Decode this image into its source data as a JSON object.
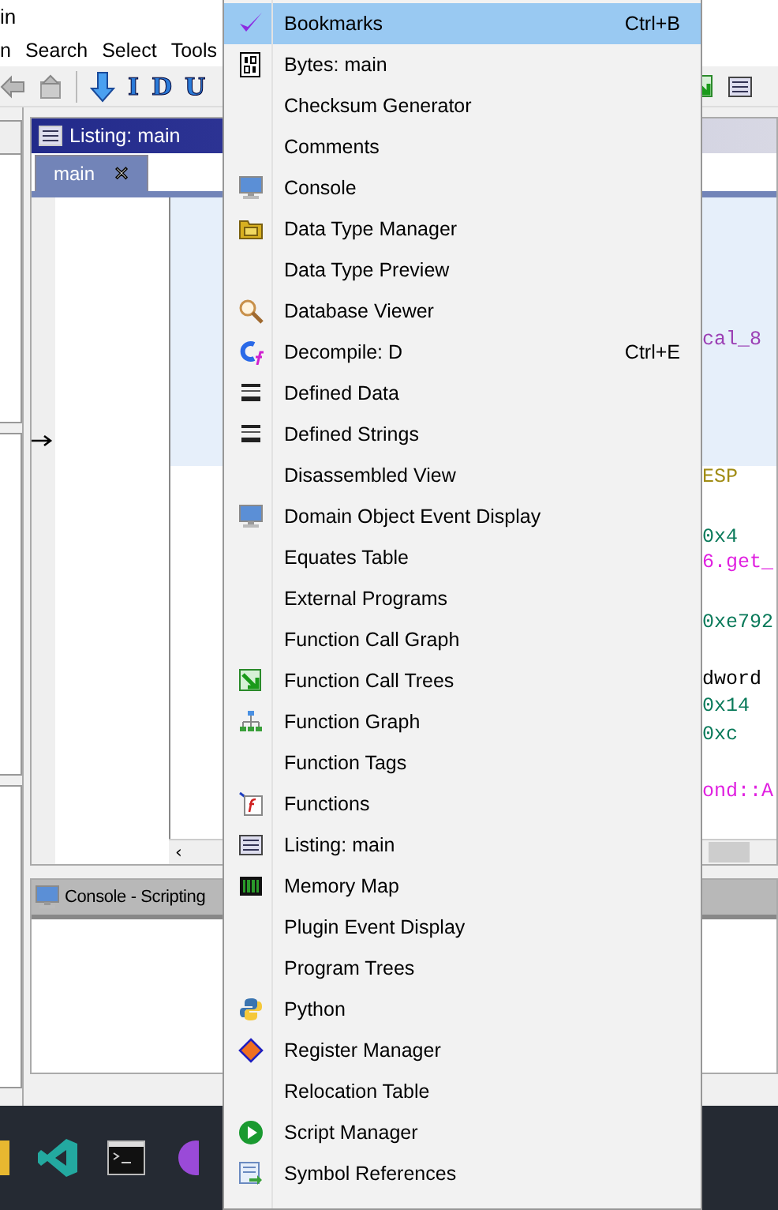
{
  "window": {
    "title": "in"
  },
  "menu_bar": [
    "n",
    "Search",
    "Select",
    "Tools"
  ],
  "toolbar": {
    "letters": [
      "I",
      "D",
      "U"
    ]
  },
  "listing": {
    "title": "Listing: main",
    "tabs": [
      {
        "label": "main",
        "close": "✕",
        "selected": true
      }
    ],
    "scroll_left": "‹",
    "code": [
      {
        "text": "cal_8",
        "color": "#9b3fb4"
      },
      {
        "text": "ESP",
        "color": "#a08c14"
      },
      {
        "text": "0x4",
        "color": "#0a7a5a"
      },
      {
        "text": "6.get_",
        "color": "#e020e0"
      },
      {
        "text": "0xe792",
        "color": "#0a7a5a"
      },
      {
        "text": "dword",
        "color": "#000000"
      },
      {
        "text": "0x14",
        "color": "#0a7a5a"
      },
      {
        "text": "0xc",
        "color": "#0a7a5a"
      },
      {
        "text": "ond::A",
        "color": "#e020e0"
      }
    ]
  },
  "console": {
    "title": "Console - Scripting"
  },
  "window_menu": {
    "items": [
      {
        "label": "Bookmarks",
        "shortcut": "Ctrl+B",
        "selected": true
      },
      {
        "label": "Bytes: main",
        "selected": false
      },
      {
        "label": "Checksum Generator",
        "selected": false
      },
      {
        "label": "Comments",
        "selected": false
      },
      {
        "label": "Console",
        "selected": false
      },
      {
        "label": "Data Type Manager",
        "selected": false
      },
      {
        "label": "Data Type Preview",
        "selected": false
      },
      {
        "label": "Database Viewer",
        "selected": false
      },
      {
        "label": "Decompile: D",
        "shortcut": "Ctrl+E",
        "selected": false
      },
      {
        "label": "Defined Data",
        "selected": false
      },
      {
        "label": "Defined Strings",
        "selected": false
      },
      {
        "label": "Disassembled View",
        "selected": false
      },
      {
        "label": "Domain Object Event Display",
        "selected": false
      },
      {
        "label": "Equates Table",
        "selected": false
      },
      {
        "label": "External Programs",
        "selected": false
      },
      {
        "label": "Function Call Graph",
        "selected": false
      },
      {
        "label": "Function Call Trees",
        "selected": false
      },
      {
        "label": "Function Graph",
        "selected": false
      },
      {
        "label": "Function Tags",
        "selected": false
      },
      {
        "label": "Functions",
        "selected": false
      },
      {
        "label": "Listing:  main",
        "selected": false
      },
      {
        "label": "Memory Map",
        "selected": false
      },
      {
        "label": "Plugin Event Display",
        "selected": false
      },
      {
        "label": "Program Trees",
        "selected": false
      },
      {
        "label": "Python",
        "selected": false
      },
      {
        "label": "Register Manager",
        "selected": false
      },
      {
        "label": "Relocation Table",
        "selected": false
      },
      {
        "label": "Script Manager",
        "selected": false
      },
      {
        "label": "Symbol References",
        "selected": false
      }
    ]
  }
}
